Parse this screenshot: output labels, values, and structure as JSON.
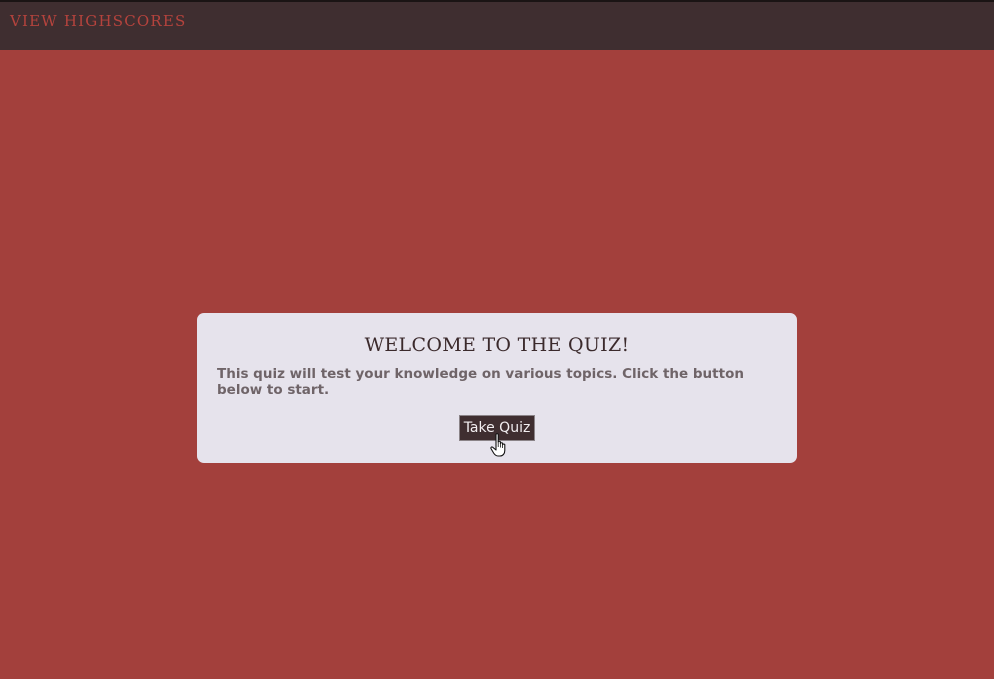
{
  "header": {
    "highscores_label": "VIEW HIGHSCORES"
  },
  "card": {
    "title": "WELCOME TO THE QUIZ!",
    "description": "This quiz will test your knowledge on various topics. Click the button below to start.",
    "button_label": "Take Quiz"
  },
  "colors": {
    "page_background": "#a3403c",
    "header_background": "#3f2e30",
    "link_color": "#b5433d",
    "card_background": "#e6e3ec",
    "button_background": "#3f2e30"
  },
  "icons": {
    "cursor": "hand-pointer-icon"
  }
}
